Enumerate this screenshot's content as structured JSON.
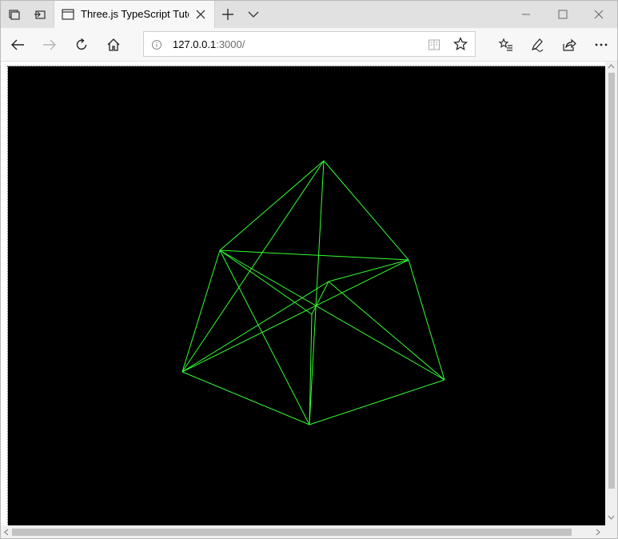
{
  "browser": {
    "tab_title": "Three.js TypeScript Tuto",
    "address": {
      "host": "127.0.0.1",
      "port_path": ":3000/"
    }
  },
  "scene": {
    "background": "#000000",
    "wire_color": "#33ff33"
  },
  "icons": {
    "set_aside": "tab-sets-icon",
    "tab_preview": "set-tabs-aside-icon",
    "new_tab": "plus-icon",
    "tab_menu": "chevron-down-icon",
    "back": "back-arrow-icon",
    "forward": "forward-arrow-icon",
    "refresh": "refresh-icon",
    "home": "home-icon",
    "info": "info-icon",
    "reading_view": "reading-view-icon",
    "favorite": "star-icon",
    "favorites": "favorites-list-icon",
    "notes": "pen-icon",
    "share": "share-icon",
    "more": "more-icon"
  }
}
